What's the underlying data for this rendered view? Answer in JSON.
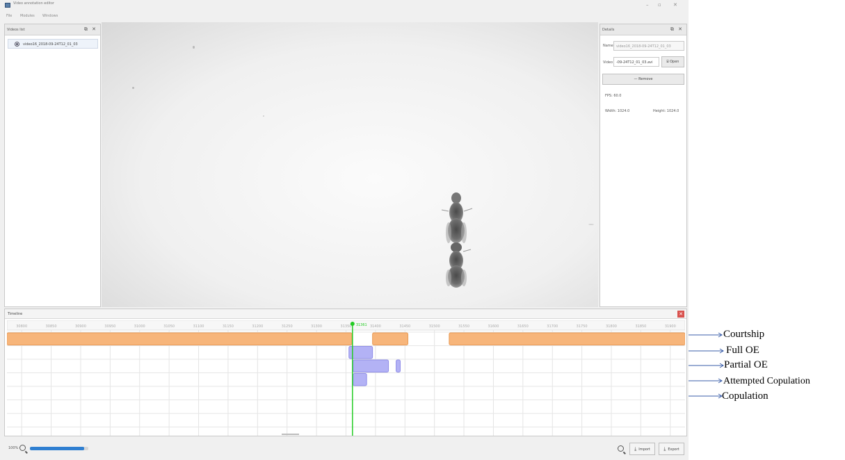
{
  "window": {
    "title": "Video annotation editor",
    "controls": {
      "minimize": "–",
      "maximize": "▫",
      "close": "✕"
    }
  },
  "menu": {
    "items": [
      "File",
      "Modules",
      "Windows"
    ]
  },
  "videos_panel": {
    "title": "Videos list",
    "header_buttons": "⧉ ✕",
    "items": [
      {
        "label": "video16_2018-09-24T12_01_03"
      }
    ]
  },
  "details_panel": {
    "title": "Details",
    "header_buttons": "⧉ ✕",
    "name_label": "Name",
    "name_value": "video16_2018-09-24T12_01_03",
    "video_label": "Video",
    "video_value": "-09-24T12_01_03.avi",
    "open_button": "⌸ Open",
    "remove_button": "— Remove",
    "fps": "FPS: 60.0",
    "width": "Width: 1024.0",
    "height": "Height: 1024.0"
  },
  "timeline": {
    "title": "Timeline",
    "close": "✕",
    "ticks": [
      "30800",
      "30850",
      "30900",
      "30950",
      "31000",
      "31050",
      "31100",
      "31150",
      "31200",
      "31250",
      "31300",
      "31350",
      "31400",
      "31450",
      "31500",
      "31550",
      "31600",
      "31650",
      "31700",
      "31750",
      "31800",
      "31850",
      "31900"
    ],
    "range": [
      30775,
      31925
    ],
    "current_frame": 31361,
    "current_frame_label": "31361",
    "tracks": [
      {
        "name": "Courtship",
        "color": "#f7b57a",
        "border": "#e89a55",
        "events": [
          [
            30775,
            31360
          ],
          [
            31395,
            31455
          ],
          [
            31525,
            31925
          ]
        ]
      },
      {
        "name": "Full OE",
        "color": "#b3b2f5",
        "border": "#8f8de8",
        "events": [
          [
            31355,
            31395
          ]
        ]
      },
      {
        "name": "Partial OE",
        "color": "#b3b2f5",
        "border": "#8f8de8",
        "events": [
          [
            31362,
            31422
          ],
          [
            31435,
            31442
          ]
        ]
      },
      {
        "name": "Attempted Copulation",
        "color": "#b3b2f5",
        "border": "#8f8de8",
        "events": [
          [
            31362,
            31385
          ]
        ]
      },
      {
        "name": "Copulation",
        "color": "#b3b2f5",
        "border": "#8f8de8",
        "events": []
      }
    ]
  },
  "bottom_bar": {
    "zoom_label": "100%",
    "zoom_fraction": 0.93,
    "import_label": "Import",
    "export_label": "Export",
    "import_icon": "⤓",
    "export_icon": "⤓"
  },
  "annotations": [
    "Courtship",
    "Full OE",
    "Partial OE",
    "Attempted Copulation",
    "Copulation"
  ],
  "colors": {
    "playhead": "#22cc22",
    "accent": "#2f7fd1",
    "close_red": "#d9534f"
  }
}
